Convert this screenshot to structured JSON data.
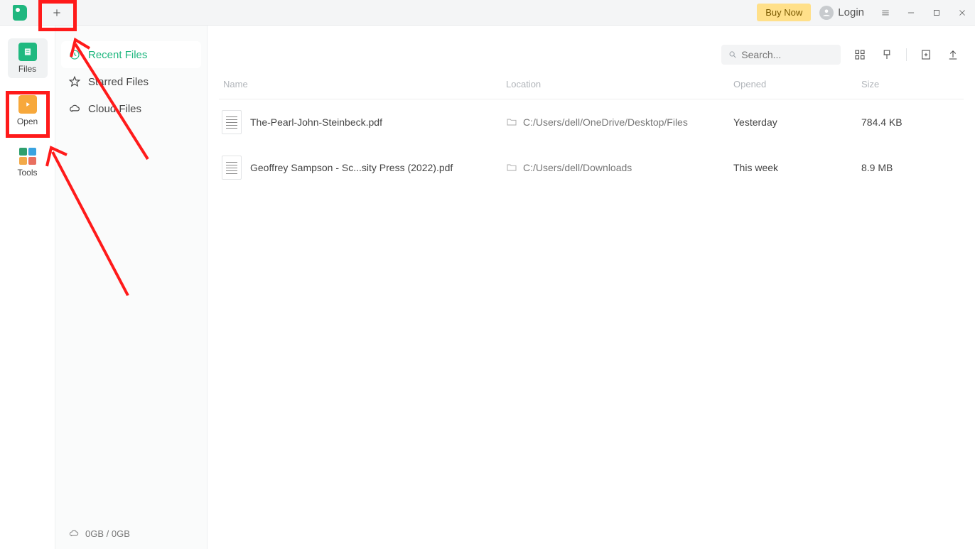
{
  "titlebar": {
    "buy_now": "Buy Now",
    "login": "Login"
  },
  "rail": {
    "items": [
      {
        "label": "Files"
      },
      {
        "label": "Open"
      },
      {
        "label": "Tools"
      }
    ]
  },
  "filenav": {
    "items": [
      {
        "label": "Recent Files"
      },
      {
        "label": "Starred Files"
      },
      {
        "label": "Cloud Files"
      }
    ],
    "storage": "0GB / 0GB"
  },
  "main": {
    "search_placeholder": "Search...",
    "columns": {
      "name": "Name",
      "location": "Location",
      "opened": "Opened",
      "size": "Size"
    },
    "rows": [
      {
        "name": "The-Pearl-John-Steinbeck.pdf",
        "location": "C:/Users/dell/OneDrive/Desktop/Files",
        "opened": "Yesterday",
        "size": "784.4 KB"
      },
      {
        "name": "Geoffrey Sampson - Sc...sity Press (2022).pdf",
        "location": "C:/Users/dell/Downloads",
        "opened": "This week",
        "size": "8.9 MB"
      }
    ]
  }
}
